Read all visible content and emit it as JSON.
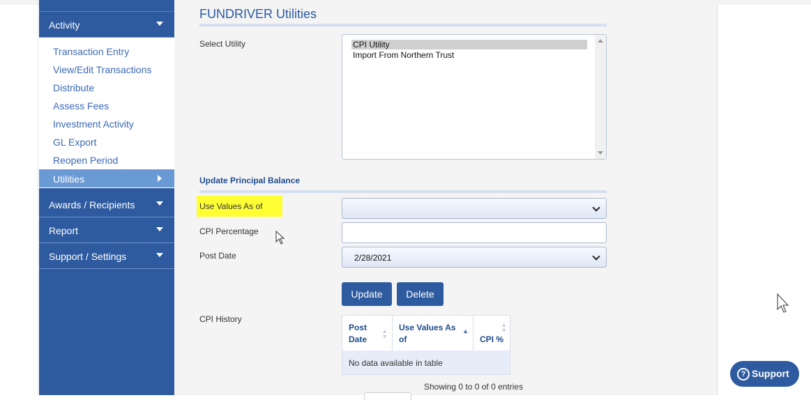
{
  "sidebar": {
    "sections": [
      {
        "label": "Activity"
      },
      {
        "label": "Awards / Recipients"
      },
      {
        "label": "Report"
      },
      {
        "label": "Support / Settings"
      }
    ],
    "activity_items": [
      {
        "label": "Transaction Entry"
      },
      {
        "label": "View/Edit Transactions"
      },
      {
        "label": "Distribute"
      },
      {
        "label": "Assess Fees"
      },
      {
        "label": "Investment Activity"
      },
      {
        "label": "GL Export"
      },
      {
        "label": "Reopen Period"
      },
      {
        "label": "Utilities"
      }
    ]
  },
  "main": {
    "title": "FUNDRIVER Utilities",
    "select_utility_label": "Select Utility",
    "utility_options": [
      "CPI Utility",
      "Import From Northern Trust"
    ],
    "update_section_title": "Update Principal Balance",
    "use_values_label": "Use Values As of",
    "use_values_value": "",
    "cpi_percentage_label": "CPI Percentage",
    "cpi_percentage_value": "",
    "post_date_label": "Post Date",
    "post_date_value": "2/28/2021",
    "update_button": "Update",
    "delete_button": "Delete",
    "cpi_history_label": "CPI History",
    "table": {
      "headers": [
        "Post Date",
        "Use Values As of",
        "CPI %"
      ],
      "empty_message": "No data available in table",
      "info": "Showing 0 to 0 of 0 entries"
    }
  },
  "support_button": {
    "label": "Support"
  },
  "colors": {
    "sidebar": "#2e5b9f",
    "active_item": "#6a9ad4",
    "link": "#3c69b6",
    "highlight": "#ffff33"
  }
}
